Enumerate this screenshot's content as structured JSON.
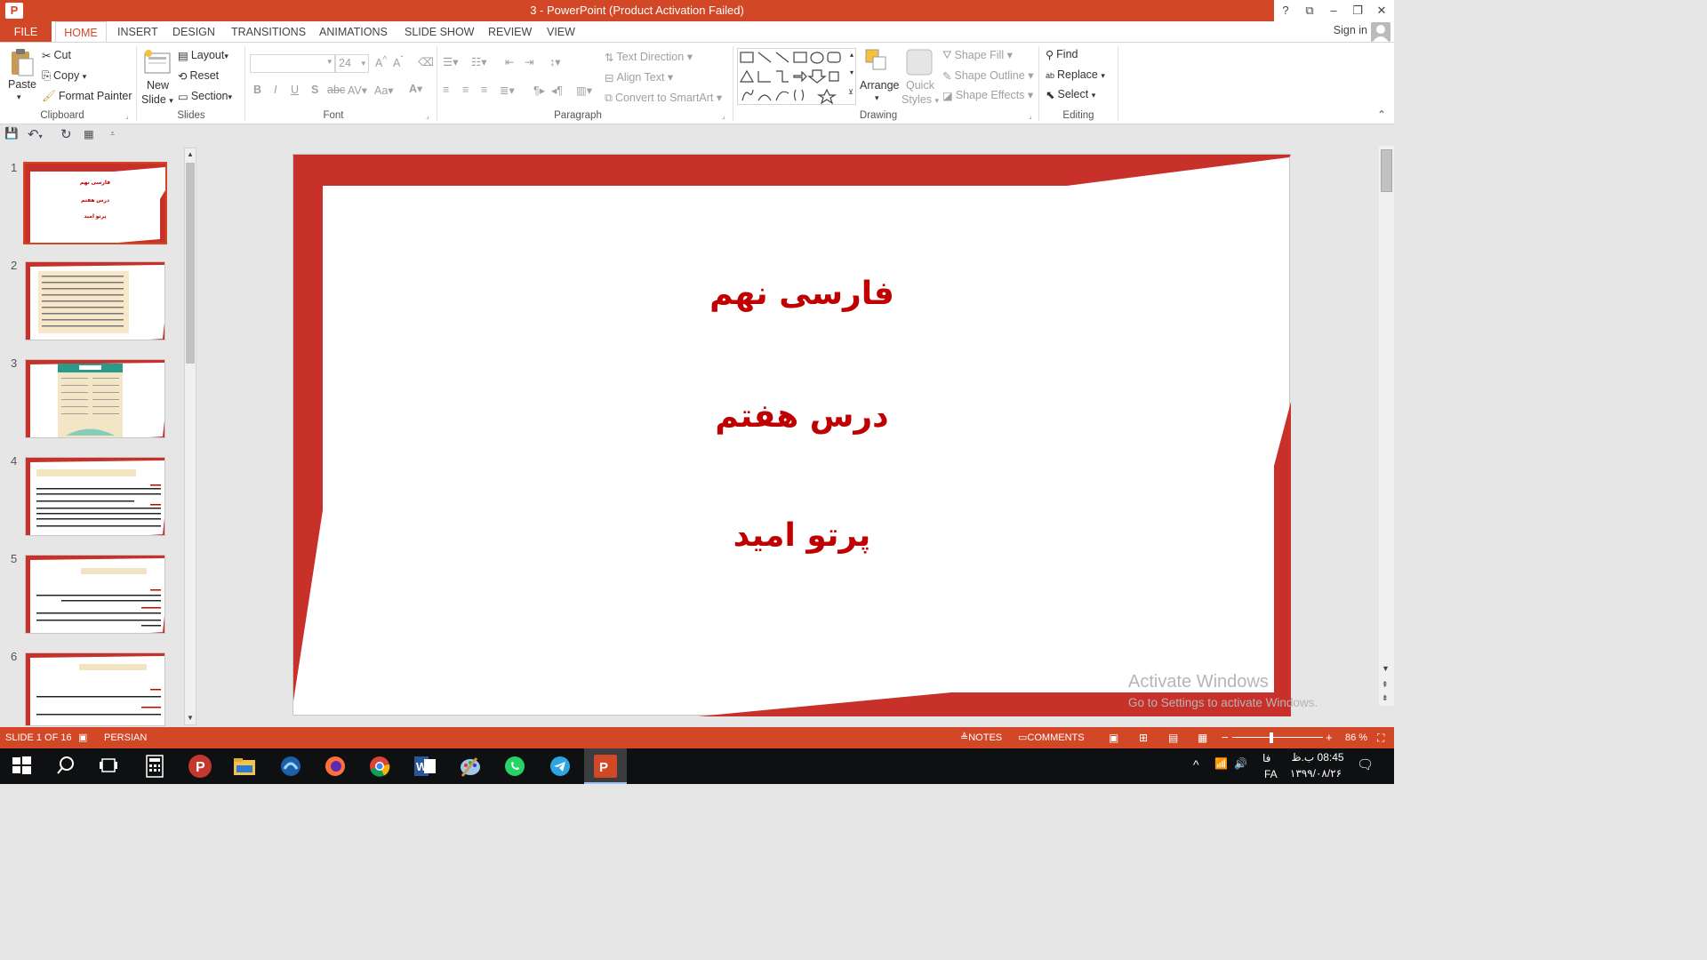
{
  "window": {
    "title": "3 -  PowerPoint (Product Activation Failed)",
    "app_icon": "P",
    "controls": [
      "?",
      "⧉",
      "–",
      "❐",
      "✕"
    ]
  },
  "ribbon_tabs": [
    "FILE",
    "HOME",
    "INSERT",
    "DESIGN",
    "TRANSITIONS",
    "ANIMATIONS",
    "SLIDE SHOW",
    "REVIEW",
    "VIEW"
  ],
  "sign_in": "Sign in",
  "clipboard": {
    "paste": "Paste",
    "cut": "Cut",
    "copy": "Copy",
    "format_painter": "Format Painter",
    "label": "Clipboard"
  },
  "slides_group": {
    "new_slide_1": "New",
    "new_slide_2": "Slide",
    "layout": "Layout",
    "reset": "Reset",
    "section": "Section",
    "label": "Slides"
  },
  "font_group": {
    "font_size": "24",
    "label": "Font"
  },
  "paragraph_group": {
    "text_direction": "Text Direction",
    "align_text": "Align Text",
    "convert_smartart": "Convert to SmartArt",
    "label": "Paragraph"
  },
  "drawing_group": {
    "arrange": "Arrange",
    "quick_styles_1": "Quick",
    "quick_styles_2": "Styles",
    "shape_fill": "Shape Fill",
    "shape_outline": "Shape Outline",
    "shape_effects": "Shape Effects",
    "label": "Drawing"
  },
  "editing_group": {
    "find": "Find",
    "replace": "Replace",
    "select": "Select",
    "label": "Editing"
  },
  "thumbnails": [
    {
      "num": "1",
      "lines": [
        "فارسی نهم",
        "درس هفتم",
        "پرتو امید"
      ]
    },
    {
      "num": "2"
    },
    {
      "num": "3"
    },
    {
      "num": "4"
    },
    {
      "num": "5"
    },
    {
      "num": "6"
    }
  ],
  "slide": {
    "line1": "فارسی نهم",
    "line2": "درس هفتم",
    "line3": "پرتو امید"
  },
  "watermark": {
    "line1": "Activate Windows",
    "line2": "Go to Settings to activate Windows."
  },
  "statusbar": {
    "slide_of": "SLIDE 1 OF 16",
    "language": "PERSIAN",
    "notes": "NOTES",
    "comments": "COMMENTS",
    "zoom": "86 %"
  },
  "taskbar": {
    "time": "08:45 ب.ظ",
    "date": "۱۳۹۹/۰۸/۲۶",
    "lang1": "فا",
    "lang2": "FA"
  },
  "colors": {
    "accent": "#d24726",
    "slide_red": "#c8302a",
    "slide_text": "#c00000"
  }
}
